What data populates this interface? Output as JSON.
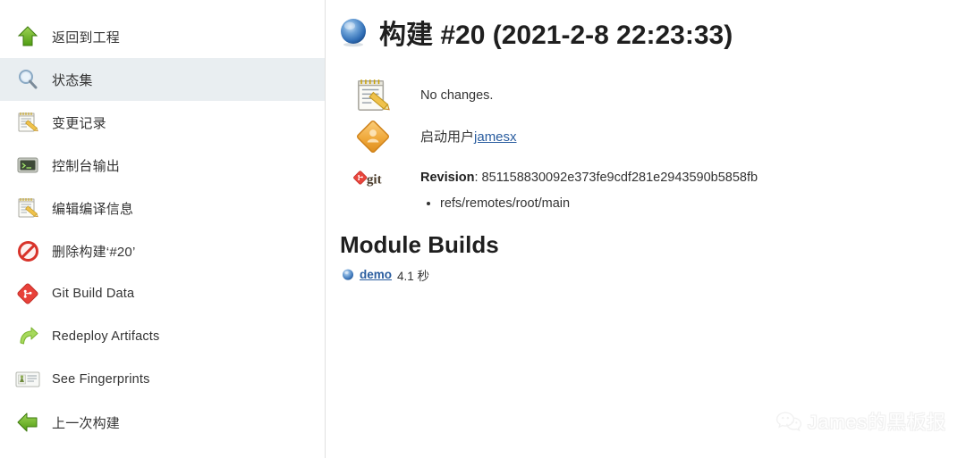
{
  "sidebar": {
    "items": [
      {
        "label": "返回到工程",
        "icon": "up-arrow-green-icon",
        "selected": false
      },
      {
        "label": "状态集",
        "icon": "magnifier-icon",
        "selected": true
      },
      {
        "label": "变更记录",
        "icon": "notepad-pencil-icon",
        "selected": false
      },
      {
        "label": "控制台输出",
        "icon": "terminal-icon",
        "selected": false
      },
      {
        "label": "编辑编译信息",
        "icon": "notepad-pencil-icon",
        "selected": false
      },
      {
        "label": "删除构建‘#20’",
        "icon": "no-entry-red-icon",
        "selected": false
      },
      {
        "label": "Git Build Data",
        "icon": "git-diamond-red-icon",
        "selected": false
      },
      {
        "label": "Redeploy Artifacts",
        "icon": "redeploy-arrow-icon",
        "selected": false
      },
      {
        "label": "See Fingerprints",
        "icon": "id-card-icon",
        "selected": false
      },
      {
        "label": "上一次构建",
        "icon": "left-arrow-green-icon",
        "selected": false
      }
    ]
  },
  "build": {
    "status_icon": "blue-sphere-icon",
    "title": "构建 #20 (2021-2-8 22:23:33)",
    "changes": {
      "icon": "notepad-pencil-icon",
      "text": "No changes."
    },
    "cause": {
      "icon": "orange-diamond-user-icon",
      "prefix": "启动用户",
      "user": "jamesx"
    },
    "scm": {
      "icon": "git-logo-icon",
      "revision_label": "Revision",
      "revision_separator": ": ",
      "revision_hash": "851158830092e373fe9cdf281e2943590b5858fb",
      "branches": [
        "refs/remotes/root/main"
      ]
    }
  },
  "modules": {
    "heading": "Module Builds",
    "rows": [
      {
        "icon": "blue-sphere-icon",
        "name": "demo",
        "duration": "4.1 秒"
      }
    ]
  },
  "watermark": {
    "icon": "wechat-icon",
    "text": "James的黑板报"
  },
  "colors": {
    "accent_blue": "#2a5d9f",
    "selected_bg": "#e9eef1",
    "text": "#333333",
    "green": "#5da81f",
    "red": "#d33c2e",
    "orange": "#f0a93c"
  }
}
